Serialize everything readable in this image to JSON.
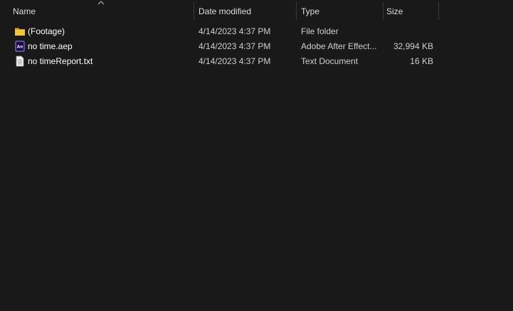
{
  "columns": {
    "name": "Name",
    "date_modified": "Date modified",
    "type": "Type",
    "size": "Size"
  },
  "files": [
    {
      "name": "(Footage)",
      "date_modified": "4/14/2023 4:37 PM",
      "type": "File folder",
      "size": "",
      "icon": "folder-icon"
    },
    {
      "name": "no time.aep",
      "date_modified": "4/14/2023 4:37 PM",
      "type": "Adobe After Effect...",
      "size": "32,994 KB",
      "icon": "after-effects-icon"
    },
    {
      "name": "no timeReport.txt",
      "date_modified": "4/14/2023 4:37 PM",
      "type": "Text Document",
      "size": "16 KB",
      "icon": "text-document-icon"
    }
  ],
  "colors": {
    "background": "#191919",
    "folder": "#f3c63c",
    "after_effects_bg": "#1f0740",
    "after_effects_accent": "#9a8cff"
  }
}
